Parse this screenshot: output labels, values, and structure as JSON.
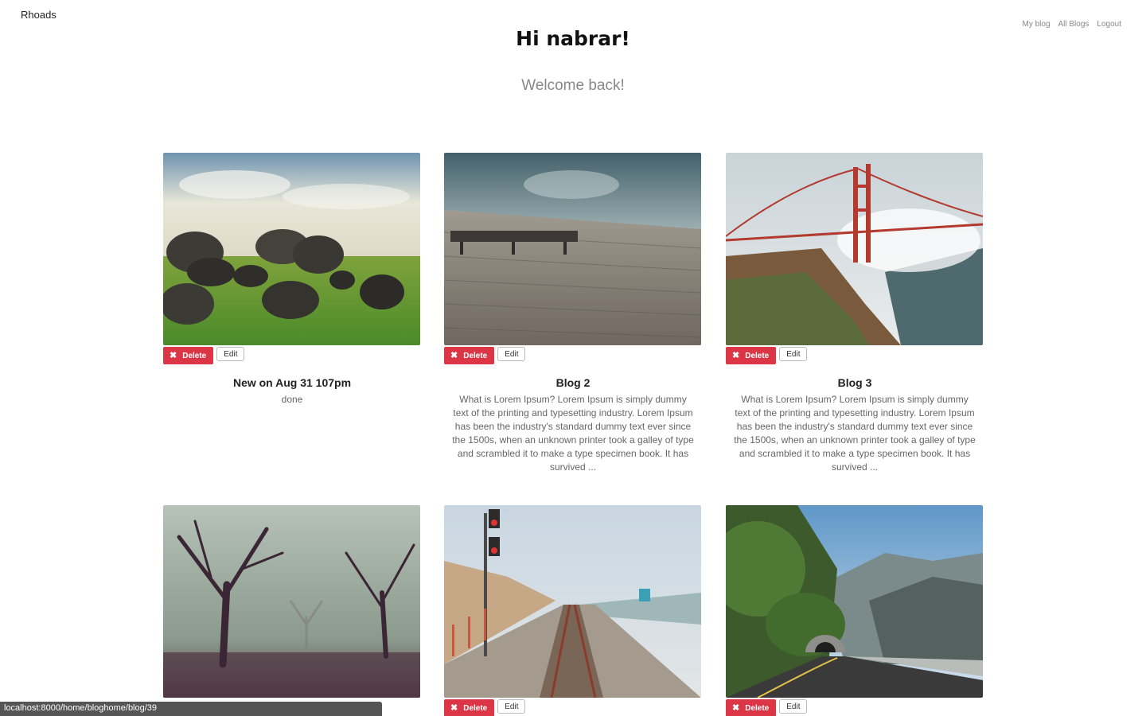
{
  "brand": "Rhoads",
  "nav": [
    "My blog",
    "All Blogs",
    "Logout"
  ],
  "greeting": "Hi nabrar!",
  "welcome": "Welcome back!",
  "delete_label": "Delete",
  "edit_label": "Edit",
  "posts": [
    {
      "title": "New on Aug 31 107pm",
      "excerpt": "done",
      "image": "stones-in-grass-field"
    },
    {
      "title": "Blog 2",
      "excerpt": "What is Lorem Ipsum? Lorem Ipsum is simply dummy text of the printing and typesetting industry. Lorem Ipsum has been the industry's standard dummy text ever since the 1500s, when an unknown printer took a galley of type and scrambled it to make a type specimen book. It has survived ...",
      "image": "bench-on-pier-by-water"
    },
    {
      "title": "Blog 3",
      "excerpt": "What is Lorem Ipsum? Lorem Ipsum is simply dummy text of the printing and typesetting industry. Lorem Ipsum has been the industry's standard dummy text ever since the 1500s, when an unknown printer took a galley of type and scrambled it to make a type specimen book. It has survived ...",
      "image": "golden-gate-bridge-in-fog"
    },
    {
      "title": "",
      "excerpt": "",
      "image": "foggy-trees-in-park"
    },
    {
      "title": "",
      "excerpt": "",
      "image": "railway-track-by-beach"
    },
    {
      "title": "",
      "excerpt": "",
      "image": "mountain-road-tunnel"
    }
  ],
  "status_url": "localhost:8000/home/bloghome/blog/39",
  "colors": {
    "delete": "#dc3545",
    "muted_text": "#888888"
  }
}
